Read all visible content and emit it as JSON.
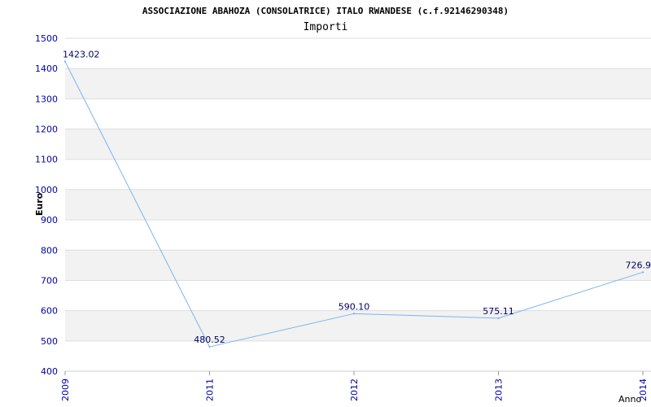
{
  "chart_data": {
    "type": "line",
    "title": "ASSOCIAZIONE ABAHOZA (CONSOLATRICE) ITALO RWANDESE (c.f.92146290348)",
    "subtitle": "Importi",
    "xlabel": "Anno",
    "ylabel": "Euro",
    "x": [
      "2009",
      "2011",
      "2012",
      "2013",
      "2014"
    ],
    "series": [
      {
        "values": [
          1423.02,
          480.52,
          590.1,
          575.11,
          726.9
        ],
        "labels": [
          "1423.02",
          "480.52",
          "590.10",
          "575.11",
          "726.9"
        ]
      }
    ],
    "ylim": [
      400,
      1500
    ],
    "yticks": [
      "400",
      "500",
      "600",
      "700",
      "800",
      "900",
      "1000",
      "1100",
      "1200",
      "1300",
      "1400",
      "1500"
    ],
    "grid": true,
    "colors": {
      "line": "#7cb5ec",
      "band": "#f2f2f2",
      "tick_text": "#0000aa",
      "label_text": "#000066",
      "title_text": "#000000"
    }
  }
}
